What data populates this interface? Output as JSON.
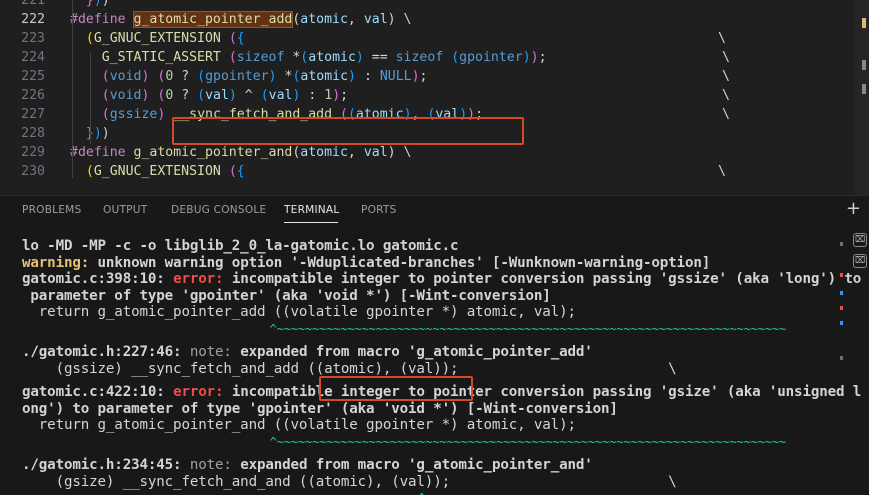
{
  "editor": {
    "lines": [
      {
        "num": "221",
        "tokens": [
          [
            "",
            "  "
          ],
          [
            "brk",
            "}"
          ],
          [
            "br2",
            ")"
          ],
          [
            "",
            ")"
          ]
        ]
      },
      {
        "num": "222",
        "current": true,
        "tokens": [
          [
            "mac",
            "#define"
          ],
          [
            "",
            " "
          ],
          [
            "find",
            "g_atomic_pointer_add"
          ],
          [
            "",
            "("
          ],
          [
            "par",
            "atomic"
          ],
          [
            "",
            ", "
          ],
          [
            "par",
            "val"
          ],
          [
            "",
            ") \\"
          ]
        ]
      },
      {
        "num": "223",
        "tokens": [
          [
            "",
            "  "
          ],
          [
            "brY",
            "("
          ],
          [
            "fn",
            "G_GNUC_EXTENSION"
          ],
          [
            "",
            " "
          ],
          [
            "brk",
            "("
          ],
          [
            "br2",
            "{"
          ]
        ]
      },
      {
        "num": "224",
        "tokens": [
          [
            "",
            "    "
          ],
          [
            "fn",
            "G_STATIC_ASSERT"
          ],
          [
            "",
            " "
          ],
          [
            "brk",
            "("
          ],
          [
            "typ",
            "sizeof"
          ],
          [
            "",
            " *"
          ],
          [
            "br2",
            "("
          ],
          [
            "par",
            "atomic"
          ],
          [
            "br2",
            ")"
          ],
          [
            "",
            " == "
          ],
          [
            "typ",
            "sizeof"
          ],
          [
            "",
            " "
          ],
          [
            "br2",
            "("
          ],
          [
            "typ",
            "gpointer"
          ],
          [
            "br2",
            ")"
          ],
          [
            "brk",
            ")"
          ],
          [
            "",
            ";"
          ]
        ]
      },
      {
        "num": "225",
        "tokens": [
          [
            "",
            "    "
          ],
          [
            "brk",
            "("
          ],
          [
            "typ",
            "void"
          ],
          [
            "brk",
            ")"
          ],
          [
            "",
            " "
          ],
          [
            "brk",
            "("
          ],
          [
            "num",
            "0"
          ],
          [
            "",
            " ? "
          ],
          [
            "br2",
            "("
          ],
          [
            "typ",
            "gpointer"
          ],
          [
            "br2",
            ")"
          ],
          [
            "",
            " *"
          ],
          [
            "br2",
            "("
          ],
          [
            "par",
            "atomic"
          ],
          [
            "br2",
            ")"
          ],
          [
            "",
            " : "
          ],
          [
            "typ",
            "NULL"
          ],
          [
            "brk",
            ")"
          ],
          [
            "",
            ";"
          ]
        ]
      },
      {
        "num": "226",
        "tokens": [
          [
            "",
            "    "
          ],
          [
            "brk",
            "("
          ],
          [
            "typ",
            "void"
          ],
          [
            "brk",
            ")"
          ],
          [
            "",
            " "
          ],
          [
            "brk",
            "("
          ],
          [
            "num",
            "0"
          ],
          [
            "",
            " ? "
          ],
          [
            "br2",
            "("
          ],
          [
            "par",
            "val"
          ],
          [
            "br2",
            ")"
          ],
          [
            "",
            " ^ "
          ],
          [
            "br2",
            "("
          ],
          [
            "par",
            "val"
          ],
          [
            "br2",
            ")"
          ],
          [
            "",
            " : "
          ],
          [
            "num",
            "1"
          ],
          [
            "brk",
            ")"
          ],
          [
            "",
            ";"
          ]
        ]
      },
      {
        "num": "227",
        "tokens": [
          [
            "",
            "    "
          ],
          [
            "brk",
            "("
          ],
          [
            "typ",
            "gssize"
          ],
          [
            "brk",
            ")"
          ],
          [
            "",
            " "
          ],
          [
            "fn",
            "__sync_fetch_and_add"
          ],
          [
            "",
            " "
          ],
          [
            "brk",
            "("
          ],
          [
            "br2",
            "("
          ],
          [
            "par",
            "atomic"
          ],
          [
            "br2",
            ")"
          ],
          [
            "",
            ", "
          ],
          [
            "br2",
            "("
          ],
          [
            "par",
            "val"
          ],
          [
            "br2",
            ")"
          ],
          [
            "brk",
            ")"
          ],
          [
            "",
            ";"
          ]
        ]
      },
      {
        "num": "228",
        "tokens": [
          [
            "",
            "  "
          ],
          [
            "brk",
            "}"
          ],
          [
            "br2",
            ")"
          ],
          [
            "",
            ")"
          ]
        ]
      },
      {
        "num": "229",
        "tokens": [
          [
            "mac",
            "#define"
          ],
          [
            "",
            " "
          ],
          [
            "fn",
            "g_atomic_pointer_and"
          ],
          [
            "",
            "("
          ],
          [
            "par",
            "atomic"
          ],
          [
            "",
            ", "
          ],
          [
            "par",
            "val"
          ],
          [
            "",
            ") \\"
          ]
        ]
      },
      {
        "num": "230",
        "tokens": [
          [
            "",
            "  "
          ],
          [
            "brY",
            "("
          ],
          [
            "fn",
            "G_GNUC_EXTENSION"
          ],
          [
            "",
            " "
          ],
          [
            "brk",
            "("
          ],
          [
            "br2",
            "{"
          ]
        ]
      }
    ],
    "line_continuation": "\\"
  },
  "panel": {
    "tabs": [
      {
        "label": "PROBLEMS"
      },
      {
        "label": "OUTPUT"
      },
      {
        "label": "DEBUG CONSOLE"
      },
      {
        "label": "TERMINAL",
        "active": true
      },
      {
        "label": "PORTS"
      }
    ],
    "new_terminal_label": "+",
    "terminal_lines": [
      {
        "style": "bold",
        "segs": [
          [
            "",
            "lo -MD -MP -c -o libglib_2_0_la-gatomic.lo gatomic.c"
          ]
        ]
      },
      {
        "style": "bold",
        "segs": [
          [
            "warn",
            "warning:"
          ],
          [
            "",
            " unknown warning option '-Wduplicated-branches' [-Wunknown-warning-option]"
          ]
        ]
      },
      {
        "style": "bold",
        "segs": [
          [
            "",
            "gatomic.c:398:10: "
          ],
          [
            "err",
            "error:"
          ],
          [
            "",
            " incompatible integer to pointer conversion passing 'gssize' (aka 'long') to"
          ]
        ]
      },
      {
        "style": "bold",
        "segs": [
          [
            "",
            " parameter of type 'gpointer' (aka 'void *') [-Wint-conversion]"
          ]
        ]
      },
      {
        "style": "plain",
        "segs": [
          [
            "",
            "  return g_atomic_pointer_add ((volatile gpointer *) atomic, val);"
          ]
        ]
      },
      {
        "style": "plain",
        "segs": [
          [
            "tilde",
            "                                   ^~~~~~~~~~~~~~~~~~~~~~~~~~~~~~~~~~~~~~~~~~~~~~~~~~~~~~~~~~~~~~~~~~~~~~~~~"
          ]
        ]
      },
      {
        "style": "gap"
      },
      {
        "style": "bold",
        "segs": [
          [
            "",
            "./gatomic.h:227:46: "
          ],
          [
            "note",
            "note:"
          ],
          [
            "",
            " expanded from macro 'g_atomic_pointer_add'"
          ]
        ]
      },
      {
        "style": "plain",
        "segs": [
          [
            "",
            "    (gssize) __sync_fetch_and_add ((atomic), (val));                         \\"
          ]
        ]
      },
      {
        "style": "gap"
      },
      {
        "style": "bold",
        "segs": [
          [
            "",
            "gatomic.c:422:10: "
          ],
          [
            "err",
            "error:"
          ],
          [
            "",
            " incompatible integer to pointer conversion passing 'gsize' (aka 'unsigned l"
          ]
        ]
      },
      {
        "style": "bold",
        "segs": [
          [
            "",
            "ong') to parameter of type 'gpointer' (aka 'void *') [-Wint-conversion]"
          ]
        ]
      },
      {
        "style": "plain",
        "segs": [
          [
            "",
            "  return g_atomic_pointer_and ((volatile gpointer *) atomic, val);"
          ]
        ]
      },
      {
        "style": "plain",
        "segs": [
          [
            "tilde",
            "                                   ^~~~~~~~~~~~~~~~~~~~~~~~~~~~~~~~~~~~~~~~~~~~~~~~~~~~~~~~~~~~~~~~~~~~~~~~~"
          ]
        ]
      },
      {
        "style": "gap"
      },
      {
        "style": "bold",
        "segs": [
          [
            "",
            "./gatomic.h:234:45: "
          ],
          [
            "note",
            "note:"
          ],
          [
            "",
            " expanded from macro 'g_atomic_pointer_and'"
          ]
        ]
      },
      {
        "style": "plain",
        "segs": [
          [
            "",
            "    (gsize) __sync_fetch_and_and ((atomic), (val));                          \\"
          ]
        ]
      },
      {
        "style": "plain",
        "segs": [
          [
            "tilde",
            "                                                        ^~~~"
          ]
        ]
      }
    ]
  },
  "colors": {
    "annotation_box": "#d24a28",
    "error": "#f14c4c",
    "warning": "#e5c07b",
    "tilde": "#23d18b"
  }
}
